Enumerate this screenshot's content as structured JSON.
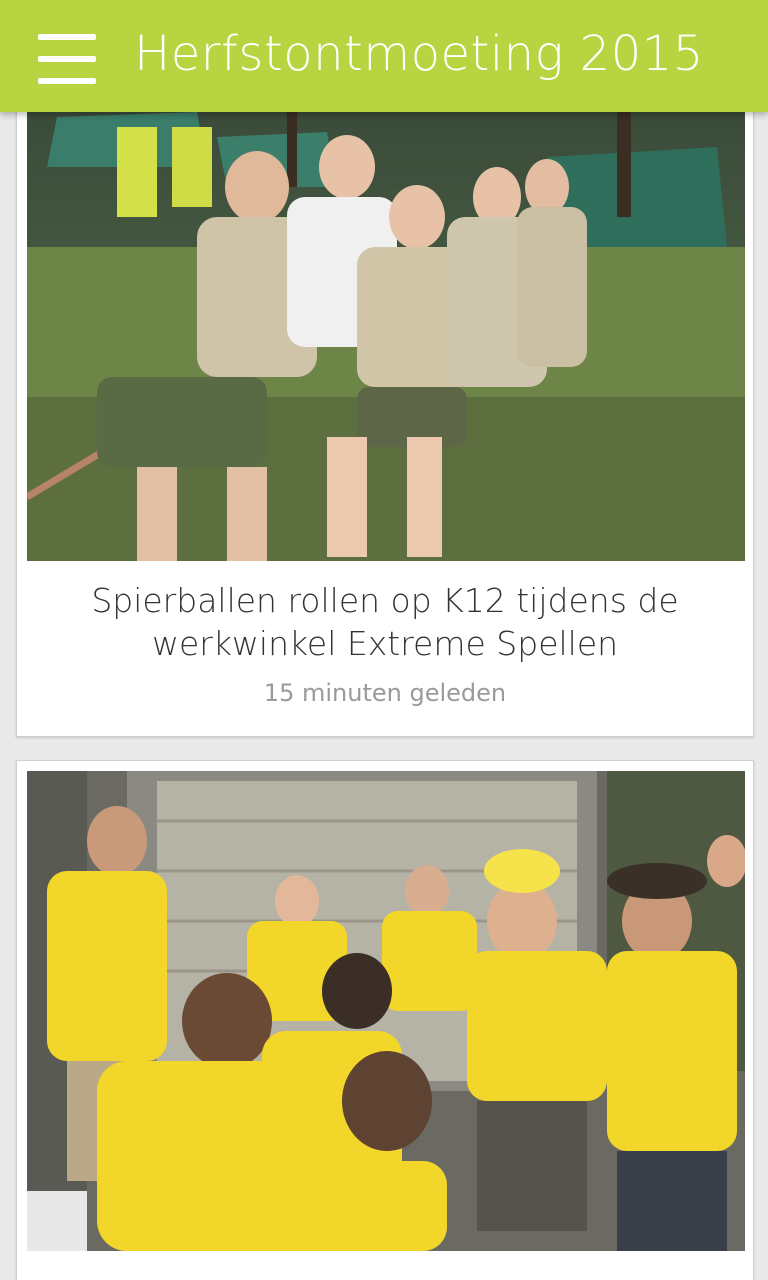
{
  "app": {
    "title": "Herfstontmoeting 2015"
  },
  "icons": {
    "menu": "hamburger-menu-icon"
  },
  "colors": {
    "appbar": "#b9d441",
    "background": "#e9e9e9"
  },
  "articles": [
    {
      "headline": "Spierballen rollen op K12 tijdens de werkwinkel Extreme Spellen",
      "time": "15 minuten geleden"
    },
    {
      "headline": "",
      "time": ""
    }
  ]
}
